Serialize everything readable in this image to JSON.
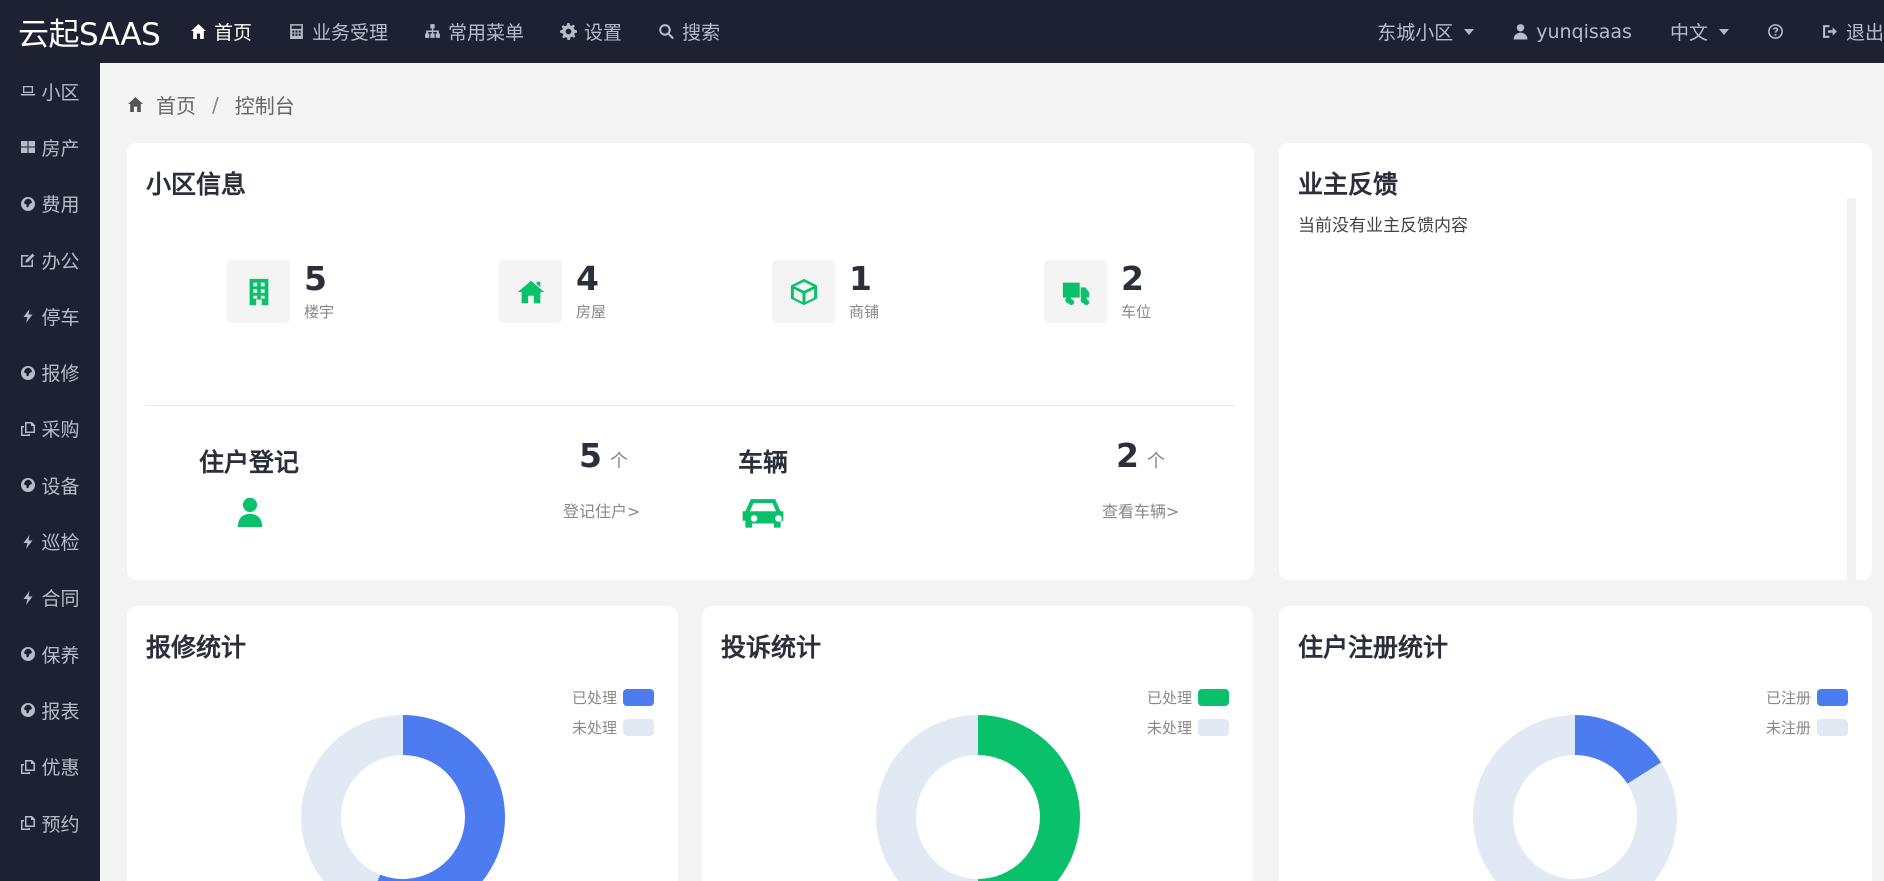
{
  "brand": "云起SAAS",
  "nav": [
    {
      "label": "首页",
      "icon": "home-icon",
      "active": true
    },
    {
      "label": "业务受理",
      "icon": "calculator-icon",
      "active": false
    },
    {
      "label": "常用菜单",
      "icon": "sitemap-icon",
      "active": false
    },
    {
      "label": "设置",
      "icon": "gear-icon",
      "active": false
    },
    {
      "label": "搜索",
      "icon": "search-icon",
      "active": false
    }
  ],
  "top_right": {
    "community": "东城小区",
    "user": "yunqisaas",
    "language": "中文",
    "logout": "退出"
  },
  "sidebar": [
    {
      "label": "小区",
      "icon": "laptop-icon"
    },
    {
      "label": "房产",
      "icon": "grid-icon"
    },
    {
      "label": "费用",
      "icon": "globe-icon"
    },
    {
      "label": "办公",
      "icon": "edit-icon"
    },
    {
      "label": "停车",
      "icon": "bolt-icon"
    },
    {
      "label": "报修",
      "icon": "globe-icon"
    },
    {
      "label": "采购",
      "icon": "copy-icon"
    },
    {
      "label": "设备",
      "icon": "globe-icon"
    },
    {
      "label": "巡检",
      "icon": "bolt-icon"
    },
    {
      "label": "合同",
      "icon": "bolt-icon"
    },
    {
      "label": "保养",
      "icon": "globe-icon"
    },
    {
      "label": "报表",
      "icon": "globe-icon"
    },
    {
      "label": "优惠",
      "icon": "copy-icon"
    },
    {
      "label": "预约",
      "icon": "copy-icon"
    }
  ],
  "breadcrumb": {
    "home": "首页",
    "current": "控制台"
  },
  "community_info": {
    "title": "小区信息",
    "stats": [
      {
        "value": "5",
        "label": "楼宇",
        "icon": "building-icon"
      },
      {
        "value": "4",
        "label": "房屋",
        "icon": "house-icon"
      },
      {
        "value": "1",
        "label": "商铺",
        "icon": "cube-icon"
      },
      {
        "value": "2",
        "label": "车位",
        "icon": "truck-icon"
      }
    ],
    "resident": {
      "title": "住户登记",
      "count": "5",
      "unit": "个",
      "link": "登记住户>"
    },
    "vehicle": {
      "title": "车辆",
      "count": "2",
      "unit": "个",
      "link": "查看车辆>"
    }
  },
  "feedback": {
    "title": "业主反馈",
    "empty_text": "当前没有业主反馈内容"
  },
  "charts": [
    {
      "title": "报修统计",
      "legend": [
        "已处理",
        "未处理"
      ],
      "colors": [
        "#4c7cf0",
        "#e1eaf4"
      ],
      "processed_fraction": 0.56
    },
    {
      "title": "投诉统计",
      "legend": [
        "已处理",
        "未处理"
      ],
      "colors": [
        "#09c16b",
        "#e1eaf4"
      ],
      "processed_fraction": 0.5
    },
    {
      "title": "住户注册统计",
      "legend": [
        "已注册",
        "未注册"
      ],
      "colors": [
        "#4c7cf0",
        "#e1eaf4"
      ],
      "processed_fraction": 0.16
    }
  ]
}
